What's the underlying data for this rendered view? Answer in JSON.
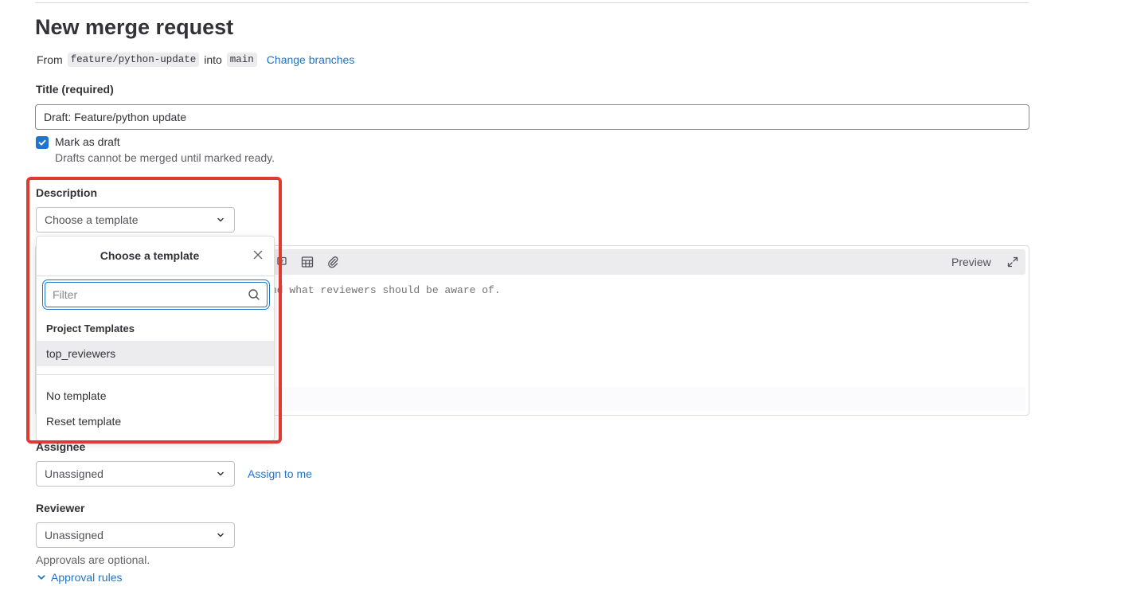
{
  "page": {
    "title": "New merge request",
    "from_text": "From",
    "source_branch": "feature/python-update",
    "into_text": "into",
    "target_branch": "main",
    "change_branches": "Change branches"
  },
  "title_field": {
    "label": "Title (required)",
    "value": "Draft: Feature/python update"
  },
  "draft": {
    "checked": true,
    "label": "Mark as draft",
    "help": "Drafts cannot be merged until marked ready."
  },
  "description": {
    "label": "Description",
    "template_select": "Choose a template",
    "preview": "Preview",
    "placeholder_visible": "nd what reviewers should be aware of."
  },
  "template_dropdown": {
    "title": "Choose a template",
    "filter_placeholder": "Filter",
    "group_label": "Project Templates",
    "items": [
      "top_reviewers"
    ],
    "no_template": "No template",
    "reset_template": "Reset template"
  },
  "assignee": {
    "label": "Assignee",
    "value": "Unassigned",
    "assign_to_me": "Assign to me"
  },
  "reviewer": {
    "label": "Reviewer",
    "value": "Unassigned",
    "approvals_note": "Approvals are optional.",
    "approval_rules": "Approval rules"
  },
  "colors": {
    "accent": "#1f75cb",
    "highlight": "#dd3a31",
    "text": "#333238",
    "muted": "#626168",
    "border": "#dcdcde"
  },
  "icons": [
    "check-icon",
    "chevron-down-icon",
    "close-icon",
    "search-icon",
    "table-icon",
    "paperclip-icon",
    "maximize-icon",
    "comment-icon"
  ]
}
